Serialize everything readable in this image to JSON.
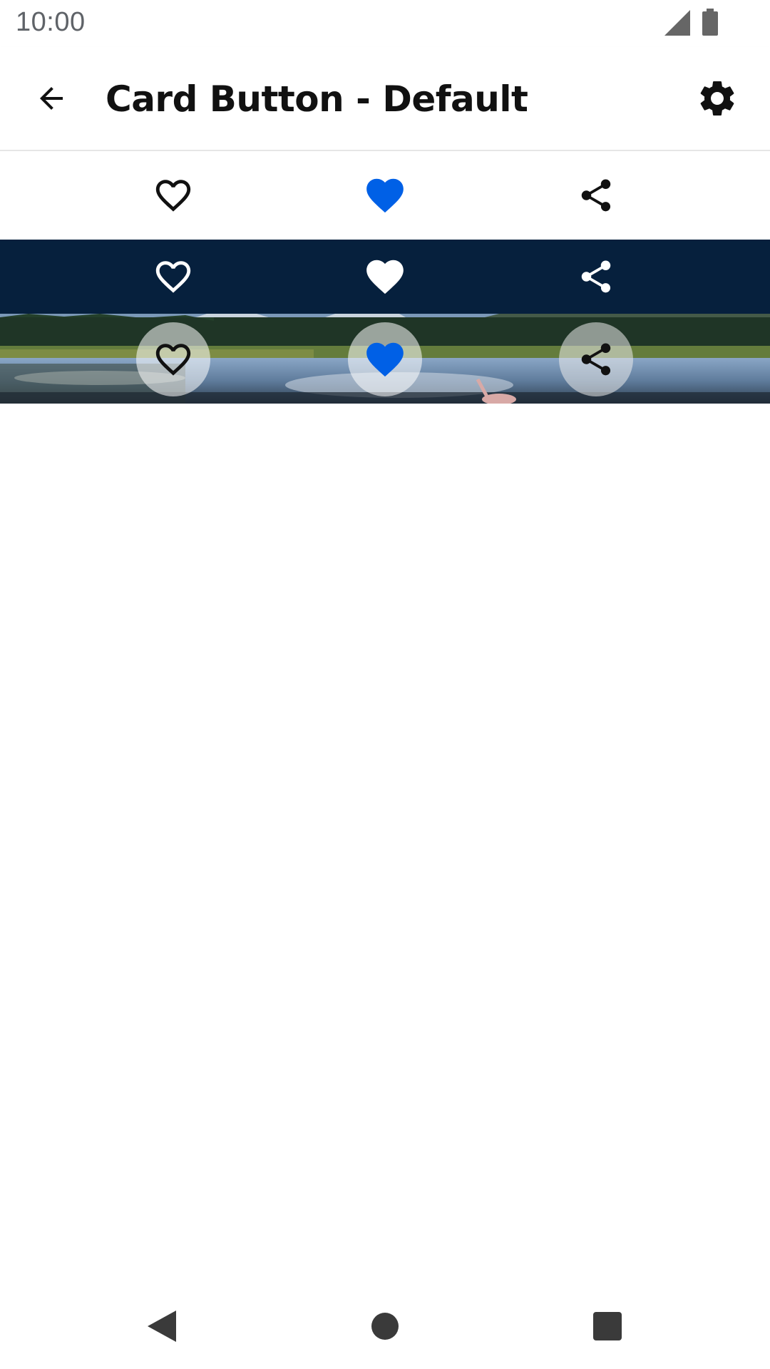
{
  "status_bar": {
    "time": "10:00",
    "signal_icon": "cellular-signal-icon",
    "battery_icon": "battery-icon"
  },
  "app_bar": {
    "title": "Card Button - Default",
    "back_icon": "arrow-back-icon",
    "settings_icon": "gear-icon"
  },
  "rows": [
    {
      "variant": "light",
      "background": "#ffffff",
      "buttons": [
        {
          "icon": "heart-outline-icon",
          "color": "#111111",
          "selected": false
        },
        {
          "icon": "heart-filled-icon",
          "color": "#0060e6",
          "selected": true
        },
        {
          "icon": "share-icon",
          "color": "#111111"
        }
      ]
    },
    {
      "variant": "dark",
      "background": "#06203d",
      "buttons": [
        {
          "icon": "heart-outline-icon",
          "color": "#ffffff",
          "selected": false
        },
        {
          "icon": "heart-filled-icon",
          "color": "#ffffff",
          "selected": true
        },
        {
          "icon": "share-icon",
          "color": "#ffffff"
        }
      ]
    },
    {
      "variant": "image",
      "background_image": "lake-landscape-photo",
      "buttons": [
        {
          "icon": "heart-outline-icon",
          "color": "#111111",
          "selected": false
        },
        {
          "icon": "heart-filled-icon",
          "color": "#0060e6",
          "selected": true
        },
        {
          "icon": "share-icon",
          "color": "#111111"
        }
      ]
    }
  ],
  "nav_bar": {
    "back_icon": "nav-back-triangle-icon",
    "home_icon": "nav-home-circle-icon",
    "recents_icon": "nav-recents-square-icon"
  }
}
